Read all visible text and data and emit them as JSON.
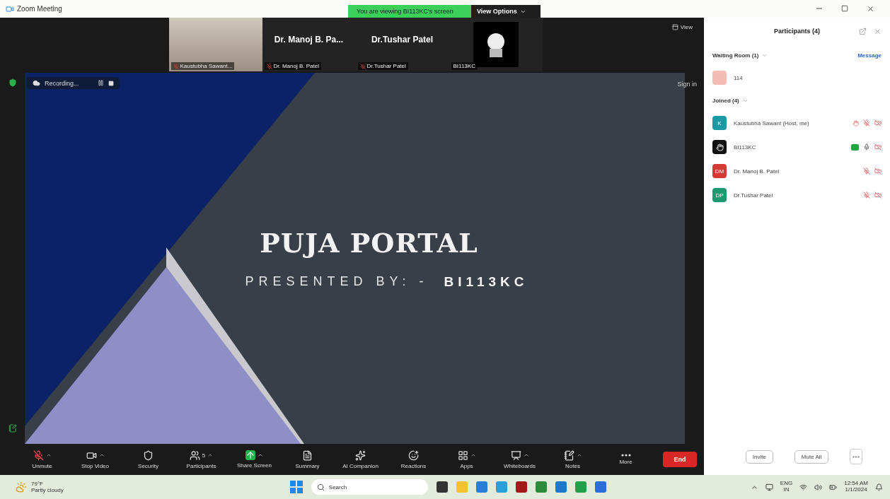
{
  "window": {
    "title": "Zoom Meeting"
  },
  "share_banner": {
    "text": "You are viewing BI113KC's screen",
    "button": "View Options"
  },
  "view_button": "View",
  "video_tiles": [
    {
      "kind": "video",
      "label": "Kaustubha Sawant...",
      "muted": true
    },
    {
      "kind": "name",
      "display": "Dr. Manoj  B. Pa...",
      "label": "Dr. Manoj B. Patel",
      "muted": true
    },
    {
      "kind": "name",
      "display": "Dr.Tushar Patel",
      "label": "Dr.Tushar Patel",
      "muted": true
    },
    {
      "kind": "avatar",
      "label": "BI113KC",
      "muted": false
    }
  ],
  "recording": {
    "label": "Recording..."
  },
  "sign_in": "Sign in",
  "slide": {
    "title": "PUJA PORTAL",
    "subtitle": "PRESENTED BY: -",
    "presenter": "BI113KC"
  },
  "toolbar": [
    {
      "kind": "mic-off",
      "label": "Unmute",
      "caret": true
    },
    {
      "kind": "video",
      "label": "Stop Video",
      "caret": true
    },
    {
      "kind": "security",
      "label": "Security",
      "caret": false
    },
    {
      "kind": "participants",
      "label": "Participants",
      "count": "5",
      "caret": true
    },
    {
      "kind": "share",
      "label": "Share Screen",
      "caret": true
    },
    {
      "kind": "summary",
      "label": "Summary",
      "caret": false
    },
    {
      "kind": "ai",
      "label": "AI Companion",
      "caret": false
    },
    {
      "kind": "reactions",
      "label": "Reactions",
      "caret": false
    },
    {
      "kind": "apps",
      "label": "Apps",
      "caret": true
    },
    {
      "kind": "whiteboard",
      "label": "Whiteboards",
      "caret": true
    },
    {
      "kind": "notes",
      "label": "Notes",
      "caret": true
    },
    {
      "kind": "more",
      "label": "More",
      "caret": false
    }
  ],
  "end_button": "End",
  "participants": {
    "title": "Participants (4)",
    "waiting_room": {
      "label": "Waiting Room (1)",
      "action": "Message",
      "people": [
        {
          "name": "114",
          "color": "#f4bcb2"
        }
      ]
    },
    "joined": {
      "label": "Joined (4)",
      "people": [
        {
          "initials": "K",
          "name": "Kaustubha Sawant (Host, me)",
          "color": "#1b9aa6",
          "sharing": false,
          "hand": true,
          "muted": true,
          "video_off": true
        },
        {
          "name": "BI113KC",
          "color": "#111111",
          "sharing": true,
          "hand": false,
          "muted": false,
          "video_off": true
        },
        {
          "initials": "DM",
          "name": "Dr. Manoj  B. Patel",
          "color": "#d33a33",
          "sharing": false,
          "hand": false,
          "muted": true,
          "video_off": true
        },
        {
          "initials": "DP",
          "name": "Dr.Tushar Patel",
          "color": "#1d9a70",
          "sharing": false,
          "hand": false,
          "muted": true,
          "video_off": true
        }
      ]
    },
    "buttons": [
      "Invite",
      "Mute All"
    ]
  },
  "taskbar": {
    "temperature": "79°F",
    "condition": "Partly cloudy",
    "search": "Search",
    "apps": [
      {
        "color": "#333333"
      },
      {
        "color": "#f2c230"
      },
      {
        "color": "#2a7fd4"
      },
      {
        "color": "#2a9fd8"
      },
      {
        "color": "#a01818"
      },
      {
        "color": "#2e8b3a"
      },
      {
        "color": "#1e78c8"
      },
      {
        "color": "#22a04a"
      },
      {
        "color": "#2b6fd6"
      }
    ],
    "language": "ENG",
    "region": "IN",
    "time": "12:54 AM",
    "date": "1/1/2024"
  }
}
